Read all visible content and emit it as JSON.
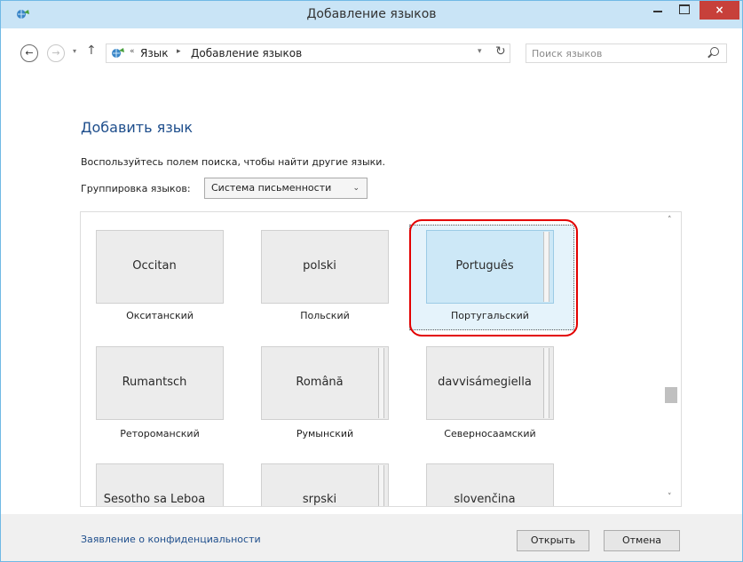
{
  "window": {
    "title": "Добавление языков",
    "close_label": "×"
  },
  "nav": {
    "back_glyph": "←",
    "forward_glyph": "→",
    "recent_glyph": "▾",
    "up_glyph": "↑",
    "breadcrumb_prefix": "«",
    "breadcrumb_sep": "▸",
    "breadcrumbs": [
      "Язык",
      "Добавление языков"
    ],
    "address_dropdown_glyph": "▾",
    "refresh_glyph": "↻",
    "search_placeholder": "Поиск языков"
  },
  "content": {
    "heading": "Добавить язык",
    "description": "Воспользуйтесь полем поиска, чтобы найти другие языки.",
    "grouping_label": "Группировка языков:",
    "grouping_value": "Система письменности",
    "grouping_arrow": "⌄"
  },
  "languages": [
    {
      "native": "Occitan",
      "localized": "Окситанский"
    },
    {
      "native": "polski",
      "localized": "Польский"
    },
    {
      "native": "Português",
      "localized": "Португальский",
      "selected": true
    },
    {
      "native": "Rumantsch",
      "localized": "Ретороманский"
    },
    {
      "native": "Română",
      "localized": "Румынский"
    },
    {
      "native": "davvisámegiella",
      "localized": "Северносаамский"
    },
    {
      "native": "Sesotho sa Leboa",
      "localized": ""
    },
    {
      "native": "srpski",
      "localized": ""
    },
    {
      "native": "slovenčina",
      "localized": ""
    }
  ],
  "scrollbar": {
    "up_glyph": "˄",
    "down_glyph": "˅"
  },
  "footer": {
    "privacy_link": "Заявление о конфиденциальности",
    "open_button": "Открыть",
    "cancel_button": "Отмена"
  },
  "colors": {
    "accent": "#1e4e8c",
    "titlebar": "#c9e4f6",
    "close_button": "#c7403a",
    "selected_tile": "#cde8f7",
    "annotation": "#e30000"
  }
}
